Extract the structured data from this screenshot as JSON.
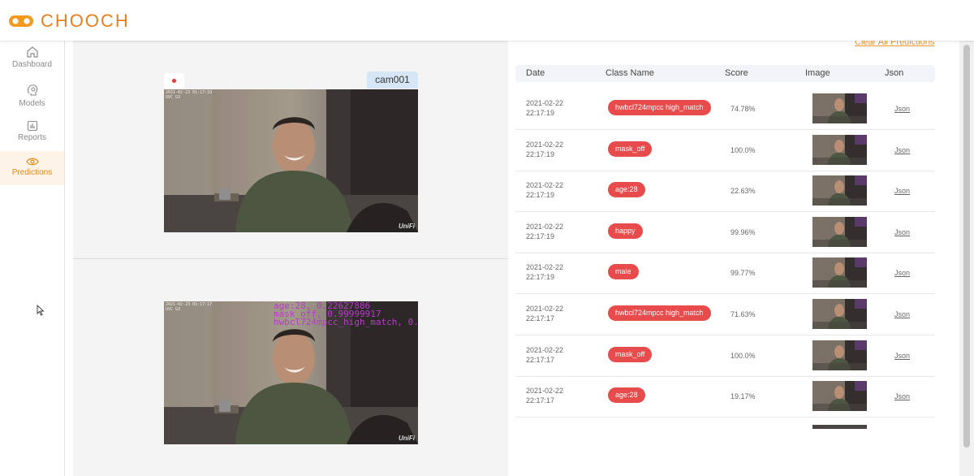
{
  "app": {
    "brand": "CHOOCH"
  },
  "sidebar": {
    "items": [
      {
        "label": "Dashboard",
        "icon": "home-icon",
        "active": false
      },
      {
        "label": "Models",
        "icon": "gear-bulb-icon",
        "active": false
      },
      {
        "label": "Reports",
        "icon": "report-icon",
        "active": false
      },
      {
        "label": "Predictions",
        "icon": "eye-icon",
        "active": true
      }
    ]
  },
  "camera": {
    "name": "cam001",
    "video_stamp": "2021-02-23 01:17:19\nUVC G3",
    "annotated_stamp": "2021-02-23 01:17:17\nUVC G3",
    "watermark": "UniFi",
    "overlay_lines": [
      "age:28, 0.22627886",
      "mask_off, 0.99999917",
      "hwbcl724mpcc_high_match, 0.747"
    ]
  },
  "predictions": {
    "clear_label": "Clear All Predictions",
    "columns": [
      "Date",
      "Class Name",
      "Score",
      "Image",
      "Json"
    ],
    "rows": [
      {
        "date": "2021-02-22",
        "time": "22:17:19",
        "class_name": "hwbcl724mpcc high_match",
        "score": "74.78%",
        "json": "Json"
      },
      {
        "date": "2021-02-22",
        "time": "22:17:19",
        "class_name": "mask_off",
        "score": "100.0%",
        "json": "Json"
      },
      {
        "date": "2021-02-22",
        "time": "22:17:19",
        "class_name": "age:28",
        "score": "22.63%",
        "json": "Json"
      },
      {
        "date": "2021-02-22",
        "time": "22:17:19",
        "class_name": "happy",
        "score": "99.96%",
        "json": "Json"
      },
      {
        "date": "2021-02-22",
        "time": "22:17:19",
        "class_name": "male",
        "score": "99.77%",
        "json": "Json"
      },
      {
        "date": "2021-02-22",
        "time": "22:17:17",
        "class_name": "hwbcl724mpcc high_match",
        "score": "71.63%",
        "json": "Json"
      },
      {
        "date": "2021-02-22",
        "time": "22:17:17",
        "class_name": "mask_off",
        "score": "100.0%",
        "json": "Json"
      },
      {
        "date": "2021-02-22",
        "time": "22:17:17",
        "class_name": "age:28",
        "score": "19.17%",
        "json": "Json"
      }
    ]
  },
  "colors": {
    "accent": "#e88a1a",
    "pill": "#e84b4b",
    "link": "#e8963a",
    "overlay": "#b83cc8"
  }
}
